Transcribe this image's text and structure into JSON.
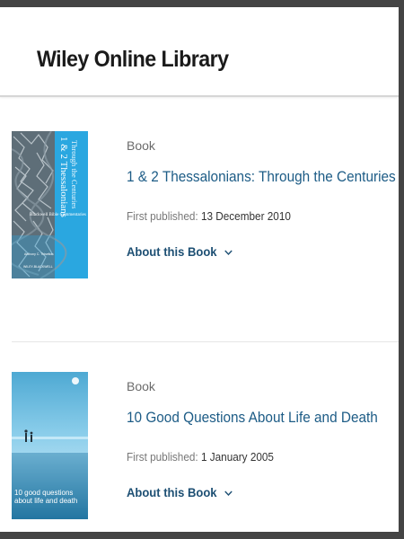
{
  "header": {
    "logo_text": "Wiley Online Library"
  },
  "results": [
    {
      "type": "Book",
      "title": "1 & 2 Thessalonians: Through the Centuries",
      "published_label": "First published:",
      "published_date": "13 December 2010",
      "about_label": "About this Book",
      "cover": {
        "title_text": "1 & 2 Thessalonians",
        "subtitle_text": "Through the Centuries",
        "series_text": "Blackwell Bible Commentaries",
        "author_text": "Anthony C. Thiselton",
        "publisher_text": "WILEY-BLACKWELL",
        "colors": {
          "primary": "#2aa7e0",
          "art": "#7a8c96"
        }
      }
    },
    {
      "type": "Book",
      "title": "10 Good Questions About Life and Death",
      "published_label": "First published:",
      "published_date": "1 January 2005",
      "about_label": "About this Book",
      "cover": {
        "title_text": "10 good questions about life and death",
        "colors": {
          "sky": "#5fb4d8",
          "sea": "#1e6f9a"
        }
      }
    }
  ],
  "colors": {
    "link": "#1d5c86",
    "about": "#1d4f73",
    "frame": "#444444"
  }
}
